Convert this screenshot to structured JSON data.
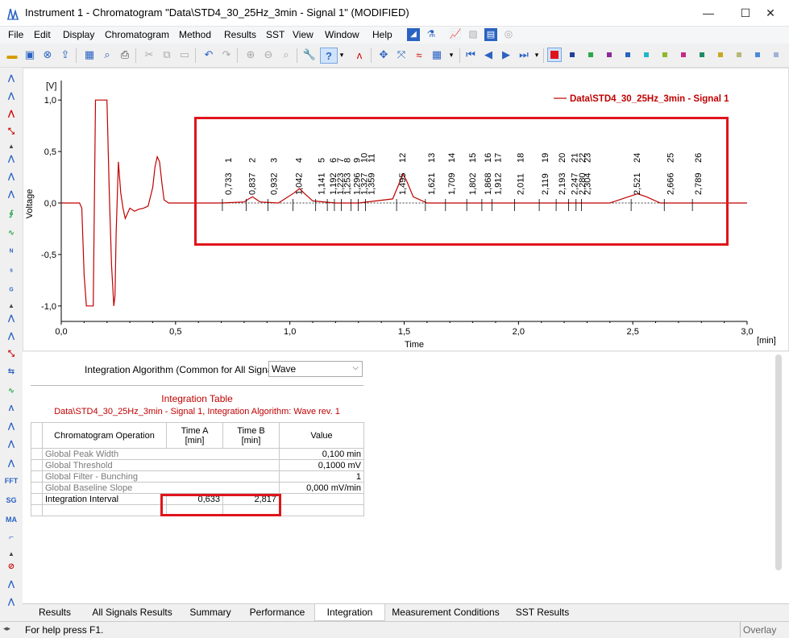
{
  "window": {
    "title": "Instrument 1 - Chromatogram \"Data\\STD4_30_25Hz_3min - Signal 1\" (MODIFIED)",
    "minimize": "—",
    "maximize": "☐",
    "close": "✕"
  },
  "menu": [
    "File",
    "Edit",
    "Display",
    "Chromatogram",
    "Method",
    "Results",
    "SST",
    "View",
    "Window",
    "Help"
  ],
  "chart_data": {
    "type": "line",
    "title": "",
    "legend": "Data\\STD4_30_25Hz_3min - Signal 1",
    "legend_placement": "top-right",
    "xlabel": "Time",
    "xunit": "[min]",
    "ylabel": "Voltage",
    "yunit": "[V]",
    "xlim": [
      0,
      3.0
    ],
    "ylim": [
      -1.15,
      1.15
    ],
    "x_ticks": [
      "0,0",
      "0,5",
      "1,0",
      "1,5",
      "2,0",
      "2,5",
      "3,0"
    ],
    "y_ticks": [
      "1,0",
      "0,5",
      "0,0",
      "-0,5",
      "-1,0"
    ],
    "series": [
      {
        "color": "#c00000",
        "x": [
          0,
          0.08,
          0.09,
          0.1,
          0.11,
          0.12,
          0.14,
          0.15,
          0.16,
          0.2,
          0.21,
          0.22,
          0.23,
          0.235,
          0.24,
          0.25,
          0.26,
          0.27,
          0.28,
          0.29,
          0.3,
          0.32,
          0.34,
          0.36,
          0.38,
          0.4,
          0.41,
          0.42,
          0.43,
          0.44,
          0.45,
          0.47,
          0.5,
          0.6,
          0.7,
          0.8,
          0.82,
          0.837,
          0.85,
          0.87,
          0.95,
          1.02,
          1.042,
          1.06,
          1.1,
          1.2,
          1.3,
          1.45,
          1.48,
          1.495,
          1.51,
          1.54,
          1.6,
          1.8,
          2.0,
          2.2,
          2.4,
          2.48,
          2.521,
          2.56,
          2.62,
          2.8,
          2.85,
          3.0
        ],
        "values": [
          0,
          0,
          -0.05,
          -0.7,
          -1.0,
          -1.0,
          -1.0,
          1.0,
          1.0,
          1.0,
          0.1,
          -0.6,
          -1.0,
          -0.9,
          -0.3,
          0.4,
          0.1,
          -0.05,
          -0.15,
          -0.1,
          -0.05,
          -0.08,
          -0.06,
          -0.05,
          -0.03,
          0.15,
          0.35,
          0.45,
          0.4,
          0.2,
          0.03,
          0.0,
          0.0,
          0.0,
          0.0,
          0.01,
          0.04,
          0.06,
          0.04,
          0.01,
          0.0,
          0.1,
          0.14,
          0.1,
          0.02,
          0.0,
          0.0,
          0.04,
          0.2,
          0.28,
          0.22,
          0.06,
          0.0,
          0.0,
          0.0,
          0.0,
          0.0,
          0.06,
          0.09,
          0.06,
          0.0,
          0.0,
          0.0,
          0.0
        ]
      }
    ],
    "peaks": [
      {
        "n": "1",
        "t": "0,733"
      },
      {
        "n": "2",
        "t": "0,837"
      },
      {
        "n": "3",
        "t": "0,932"
      },
      {
        "n": "4",
        "t": "1,042"
      },
      {
        "n": "5",
        "t": "1,141"
      },
      {
        "n": "6",
        "t": "1,192"
      },
      {
        "n": "7",
        "t": "1,223"
      },
      {
        "n": "8",
        "t": "1,253"
      },
      {
        "n": "9",
        "t": "1,296"
      },
      {
        "n": "10",
        "t": "1,327"
      },
      {
        "n": "11",
        "t": "1,359"
      },
      {
        "n": "12",
        "t": "1,495"
      },
      {
        "n": "13",
        "t": "1,621"
      },
      {
        "n": "14",
        "t": "1,709"
      },
      {
        "n": "15",
        "t": "1,802"
      },
      {
        "n": "16",
        "t": "1,868"
      },
      {
        "n": "17",
        "t": "1,912"
      },
      {
        "n": "18",
        "t": "2,011"
      },
      {
        "n": "19",
        "t": "2,119"
      },
      {
        "n": "20",
        "t": "2,193"
      },
      {
        "n": "21",
        "t": "2,247"
      },
      {
        "n": "22",
        "t": "2,280"
      },
      {
        "n": "23",
        "t": "2,304"
      },
      {
        "n": "24",
        "t": "2,521"
      },
      {
        "n": "25",
        "t": "2,666"
      },
      {
        "n": "26",
        "t": "2,789"
      }
    ]
  },
  "integration": {
    "algorithm_label": "Integration Algorithm (Common for All Signals)",
    "algorithm_value": "Wave",
    "table_title": "Integration Table",
    "table_subtitle": "Data\\STD4_30_25Hz_3min - Signal 1, Integration Algorithm: Wave rev. 1",
    "headers": {
      "op": "Chromatogram Operation",
      "timeA_1": "Time A",
      "timeA_2": "[min]",
      "timeB_1": "Time B",
      "timeB_2": "[min]",
      "value": "Value"
    },
    "rows": [
      {
        "op": "Global Peak Width",
        "a": "",
        "b": "",
        "v": "0,100 min"
      },
      {
        "op": "Global Threshold",
        "a": "",
        "b": "",
        "v": "0,1000 mV"
      },
      {
        "op": "Global Filter - Bunching",
        "a": "",
        "b": "",
        "v": "1"
      },
      {
        "op": "Global Baseline Slope",
        "a": "",
        "b": "",
        "v": "0,000 mV/min"
      },
      {
        "op": "Integration Interval",
        "a": "0,633",
        "b": "2,817",
        "v": ""
      }
    ]
  },
  "tabs": [
    "Results",
    "All Signals Results",
    "Summary",
    "Performance",
    "Integration",
    "Measurement Conditions",
    "SST Results"
  ],
  "active_tab": "Integration",
  "status": {
    "help": "For help press F1.",
    "mode": "Overlay"
  },
  "accent": {
    "signal": "#c00000",
    "highlight": "#e0141b",
    "title_red": "#c00000"
  }
}
